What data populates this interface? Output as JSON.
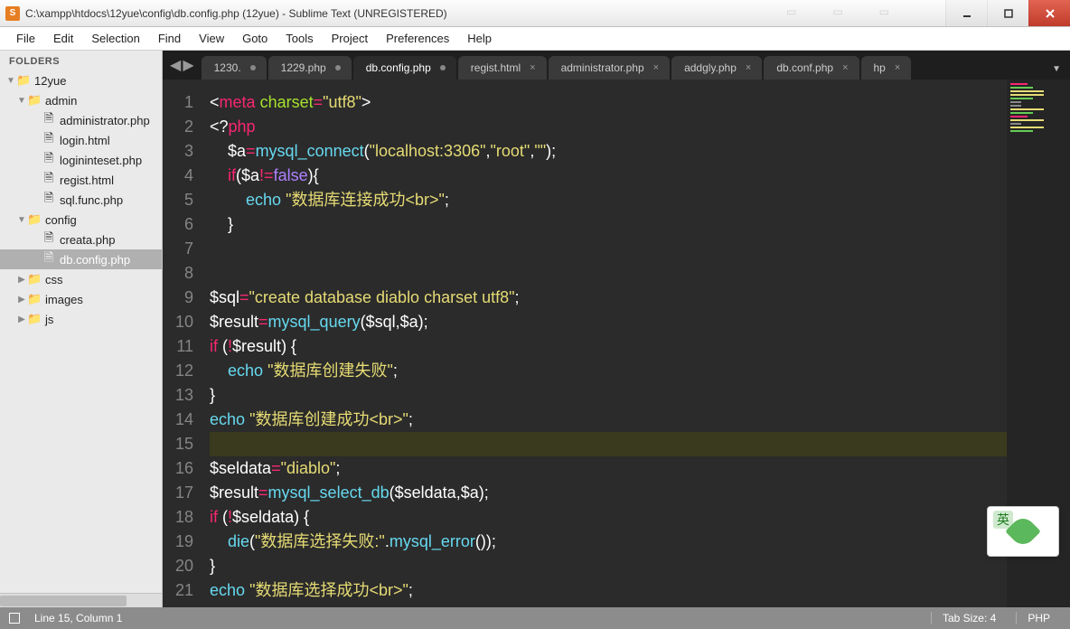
{
  "window": {
    "title": "C:\\xampp\\htdocs\\12yue\\config\\db.config.php (12yue) - Sublime Text (UNREGISTERED)"
  },
  "menu": [
    "File",
    "Edit",
    "Selection",
    "Find",
    "View",
    "Goto",
    "Tools",
    "Project",
    "Preferences",
    "Help"
  ],
  "sidebar": {
    "header": "FOLDERS",
    "tree": [
      {
        "d": 0,
        "arrow": "▼",
        "icon": "📁",
        "label": "12yue",
        "interact": true
      },
      {
        "d": 1,
        "arrow": "▼",
        "icon": "📁",
        "label": "admin",
        "interact": true
      },
      {
        "d": 2,
        "arrow": "",
        "icon": "🗎",
        "label": "administrator.php",
        "interact": true
      },
      {
        "d": 2,
        "arrow": "",
        "icon": "🗎",
        "label": "login.html",
        "interact": true
      },
      {
        "d": 2,
        "arrow": "",
        "icon": "🗎",
        "label": "logininteset.php",
        "interact": true
      },
      {
        "d": 2,
        "arrow": "",
        "icon": "🗎",
        "label": "regist.html",
        "interact": true
      },
      {
        "d": 2,
        "arrow": "",
        "icon": "🗎",
        "label": "sql.func.php",
        "interact": true
      },
      {
        "d": 1,
        "arrow": "▼",
        "icon": "📁",
        "label": "config",
        "interact": true
      },
      {
        "d": 2,
        "arrow": "",
        "icon": "🗎",
        "label": "creata.php",
        "interact": true
      },
      {
        "d": 2,
        "arrow": "",
        "icon": "🗎",
        "label": "db.config.php",
        "interact": true,
        "sel": true
      },
      {
        "d": 1,
        "arrow": "▶",
        "icon": "📁",
        "label": "css",
        "interact": true
      },
      {
        "d": 1,
        "arrow": "▶",
        "icon": "📁",
        "label": "images",
        "interact": true
      },
      {
        "d": 1,
        "arrow": "▶",
        "icon": "📁",
        "label": "js",
        "interact": true
      }
    ]
  },
  "tabs": {
    "nav_left": "◀",
    "nav_right": "▶",
    "items": [
      {
        "label": "1230.",
        "close": ""
      },
      {
        "label": "1229.php",
        "close": ""
      },
      {
        "label": "db.config.php",
        "close": "",
        "active": true
      },
      {
        "label": "regist.html",
        "close": "×"
      },
      {
        "label": "administrator.php",
        "close": "×"
      },
      {
        "label": "addgly.php",
        "close": "×"
      },
      {
        "label": "db.conf.php",
        "close": "×"
      },
      {
        "label": "hp",
        "close": "×"
      }
    ],
    "overflow": "▼"
  },
  "code": {
    "lines": [
      1,
      2,
      3,
      4,
      5,
      6,
      7,
      8,
      9,
      10,
      11,
      12,
      13,
      14,
      15,
      16,
      17,
      18,
      19,
      20,
      21
    ],
    "content": [
      "<span class='t-punc'>&lt;</span><span class='t-tag'>meta</span> <span class='t-attr'>charset</span><span class='t-op'>=</span><span class='t-str'>\"utf8\"</span><span class='t-punc'>&gt;</span>",
      "<span class='t-punc'>&lt;?</span><span class='t-tag'>php</span>",
      "    <span class='t-var'>$a</span><span class='t-op'>=</span><span class='t-func'>mysql_connect</span><span class='t-punc'>(</span><span class='t-str'>\"localhost:3306\"</span><span class='t-punc'>,</span><span class='t-str'>\"root\"</span><span class='t-punc'>,</span><span class='t-str'>\"\"</span><span class='t-punc'>);</span>",
      "    <span class='t-tag'>if</span><span class='t-punc'>(</span><span class='t-var'>$a</span><span class='t-op'>!=</span><span class='t-const'>false</span><span class='t-punc'>){</span>",
      "        <span class='t-echo'>echo</span> <span class='t-str'>\"数据库连接成功&lt;br&gt;\"</span><span class='t-punc'>;</span>",
      "    <span class='t-punc'>}</span>",
      "",
      "",
      "<span class='t-var'>$sql</span><span class='t-op'>=</span><span class='t-str'>\"create database diablo charset utf8\"</span><span class='t-punc'>;</span>",
      "<span class='t-var'>$result</span><span class='t-op'>=</span><span class='t-func'>mysql_query</span><span class='t-punc'>(</span><span class='t-var'>$sql</span><span class='t-punc'>,</span><span class='t-var'>$a</span><span class='t-punc'>);</span>",
      "<span class='t-tag'>if</span> <span class='t-punc'>(</span><span class='t-op'>!</span><span class='t-var'>$result</span><span class='t-punc'>) {</span>",
      "    <span class='t-echo'>echo</span> <span class='t-str'>\"数据库创建失败\"</span><span class='t-punc'>;</span>",
      "<span class='t-punc'>}</span>",
      "<span class='t-echo'>echo</span> <span class='t-str'>\"数据库创建成功&lt;br&gt;\"</span><span class='t-punc'>;</span>",
      "",
      "<span class='t-var'>$seldata</span><span class='t-op'>=</span><span class='t-str'>\"diablo\"</span><span class='t-punc'>;</span>",
      "<span class='t-var'>$result</span><span class='t-op'>=</span><span class='t-func'>mysql_select_db</span><span class='t-punc'>(</span><span class='t-var'>$seldata</span><span class='t-punc'>,</span><span class='t-var'>$a</span><span class='t-punc'>);</span>",
      "<span class='t-tag'>if</span> <span class='t-punc'>(</span><span class='t-op'>!</span><span class='t-var'>$seldata</span><span class='t-punc'>) {</span>",
      "    <span class='t-func'>die</span><span class='t-punc'>(</span><span class='t-str'>\"数据库选择失败:\"</span><span class='t-punc'>.</span><span class='t-func'>mysql_error</span><span class='t-punc'>());</span>",
      "<span class='t-punc'>}</span>",
      "<span class='t-echo'>echo</span> <span class='t-str'>\"数据库选择成功&lt;br&gt;\"</span><span class='t-punc'>;</span>"
    ],
    "current_line_index": 14
  },
  "status": {
    "pos": "Line 15, Column 1",
    "tab": "Tab Size: 4",
    "lang": "PHP"
  },
  "floaty_char": "英"
}
